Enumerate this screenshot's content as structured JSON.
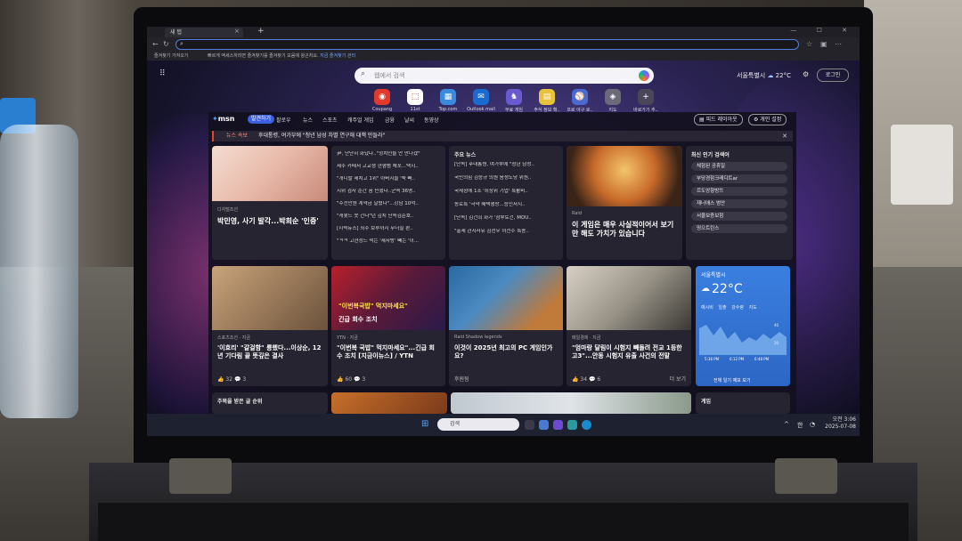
{
  "browser": {
    "tab_title": "새 탭",
    "tab_close": "×",
    "new_tab": "+",
    "window_controls": "— ☐ ✕",
    "favorites_item": "즐겨찾기 가져오기",
    "favorites_message": "빠르게 액세스하려면 즐겨찾기를 즐겨찾기 모음에 왕곤처요.",
    "favorites_link": "지금 즐겨찾기 관리"
  },
  "newtab": {
    "search_placeholder": "웹에서 검색",
    "weather_location": "서울특별시",
    "weather_temp": "22°C",
    "login_label": "로그인",
    "shortcuts": [
      {
        "label": "Coupang",
        "icon": "coupang-icon"
      },
      {
        "label": "11st",
        "icon": "11st-icon"
      },
      {
        "label": "Top.com",
        "icon": "top-icon"
      },
      {
        "label": "Outlook mail",
        "icon": "outlook-icon"
      },
      {
        "label": "무료 게임",
        "icon": "game-icon"
      },
      {
        "label": "주식 정보 확..",
        "icon": "stock-icon"
      },
      {
        "label": "프로 야구 로..",
        "icon": "baseball-icon"
      },
      {
        "label": "지도",
        "icon": "map-icon"
      },
      {
        "label": "바로가기 추..",
        "icon": "plus-icon"
      }
    ]
  },
  "feed": {
    "logo": "msn",
    "nav": [
      "발견하기",
      "팔로우",
      "뉴스",
      "스포츠",
      "캐주얼 게임",
      "금융",
      "날씨",
      "동영상"
    ],
    "feed_layout_btn": "피드 레이아웃",
    "personalize_btn": "개인 설정",
    "breaking_label": "뉴스 속보",
    "breaking_text": "후대통령, 여가부에 \"청년 남성 차별 연구해 대책 만들라\"",
    "card1": {
      "source": "디지털조선",
      "title": "박민영, 사기 발각...박희순 '인증'"
    },
    "list1": [
      "尹, 단단히 화났다..\"정치인들 안 만나겠\"",
      "제주 카페서 고교생 현행범 체포...택시..",
      "\"개니발 제치고 1위\" 아버지들 '쑥 빠..",
      "지위 검사 순간 꿈 민했다..군역 36명..",
      "\"수천만원 계약금 날렸다\"...강남 10억..",
      "\"캐봇드 못 간다\"던 김치 단속김준호..",
      "[지력뉴스] 최주 보루까지 무너질 판..",
      "\"ㅋㅋ 고현정드 먹는 '제자방' 빼는 '이..."
    ],
    "list2_head": "주요 뉴스",
    "list2": [
      "[단독] 후대통령, 여가부에 \"청년 남성..",
      "국민의힘 김승규 의원 음성도당 위원..",
      "국세청에 1조 '최상위 기업' 특활비..",
      "동로특 '극약 혜택행랑...승인서시..",
      "[단독] 김건희 화가 '삼부토건, MOU..",
      "\"출세 관지사유 김선우 이전수 특종.."
    ],
    "card3": {
      "source": "Raid",
      "title": "이 게임은 매우 사실적이어서 보기만 해도 가치가 있습니다"
    },
    "trending_head": "최신 인기 검색어",
    "trending": [
      "체험된 공휴일",
      "부당경험크레디트ar",
      "르도앙향방뜨",
      "재너애스 범안",
      "서울보증보험",
      "띵으트린스"
    ],
    "card4": {
      "source": "스포츠조선 · 지금",
      "title": "'이효리' \"갈걸함\" 릉했다...이상순, 12년 기다림 끝 뜻깊은 결사",
      "likes": "32",
      "comments": "3"
    },
    "card5": {
      "source": "YTN · 지금",
      "title": "\"이번복 국밥\" 먹지마세요\"...긴급 회수 조치 [지금이뉴스] / YTN",
      "likes": "60",
      "comments": "3",
      "overlay": "\"이번복국밥\" 먹지마세요\"",
      "overlay2": "긴급 회수 조치"
    },
    "card6": {
      "source": "Raid Shadow legends",
      "title": "이것이 2025년 최고의 PC 게임인가요?",
      "footer": "후원됨"
    },
    "card7": {
      "source": "매일경제 · 지금",
      "title": "\"엄마랑 달림이 시험지 빼돌려 전교 1등한 고3\"...안동 시험지 유출 사건의 전말",
      "likes": "34",
      "comments": "6",
      "more": "더 보기"
    },
    "weather": {
      "location": "서울특별시",
      "temp": "22°C",
      "tabs": "예시비 일출 강수량 지도",
      "times": [
        "5:36 PM",
        "6:12 PM",
        "6:48 PM"
      ],
      "cta": "전체 일기 예보 보기",
      "y_ticks": [
        "40",
        "20"
      ]
    },
    "bottom_left": "주목을 받은 글 순위",
    "bottom_right": "게임"
  },
  "taskbar": {
    "search": "검색",
    "time": "오전 3:06",
    "date": "2025-07-08",
    "lang": "한"
  },
  "colors": {
    "accent": "#3b5fe0",
    "breaking": "#e04a2a",
    "weather": "#3a7fe0"
  }
}
